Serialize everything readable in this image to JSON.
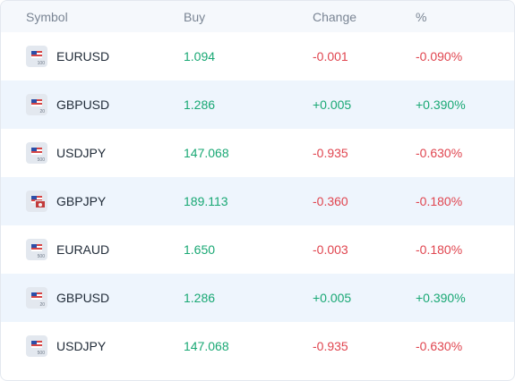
{
  "header": {
    "symbol": "Symbol",
    "buy": "Buy",
    "change": "Change",
    "percent": "%"
  },
  "rows": [
    {
      "symbol": "EURUSD",
      "buy": "1.094",
      "change": "-0.001",
      "percent": "-0.090%",
      "leverage": "100",
      "direction": "down"
    },
    {
      "symbol": "GBPUSD",
      "buy": "1.286",
      "change": "+0.005",
      "percent": "+0.390%",
      "leverage": "20",
      "direction": "up"
    },
    {
      "symbol": "USDJPY",
      "buy": "147.068",
      "change": "-0.935",
      "percent": "-0.630%",
      "leverage": "500",
      "direction": "down"
    },
    {
      "symbol": "GBPJPY",
      "buy": "189.113",
      "change": "-0.360",
      "percent": "-0.180%",
      "leverage": "",
      "direction": "down"
    },
    {
      "symbol": "EURAUD",
      "buy": "1.650",
      "change": "-0.003",
      "percent": "-0.180%",
      "leverage": "500",
      "direction": "down"
    },
    {
      "symbol": "GBPUSD",
      "buy": "1.286",
      "change": "+0.005",
      "percent": "+0.390%",
      "leverage": "20",
      "direction": "up"
    },
    {
      "symbol": "USDJPY",
      "buy": "147.068",
      "change": "-0.935",
      "percent": "-0.630%",
      "leverage": "500",
      "direction": "down"
    }
  ],
  "colors": {
    "buy": "#19a874",
    "up": "#19a874",
    "down": "#e0454f",
    "header_bg": "#f5f8fc",
    "alt_row_bg": "#eef5fd"
  },
  "icons": {
    "instrument_badge": "currency-flag-icon"
  }
}
